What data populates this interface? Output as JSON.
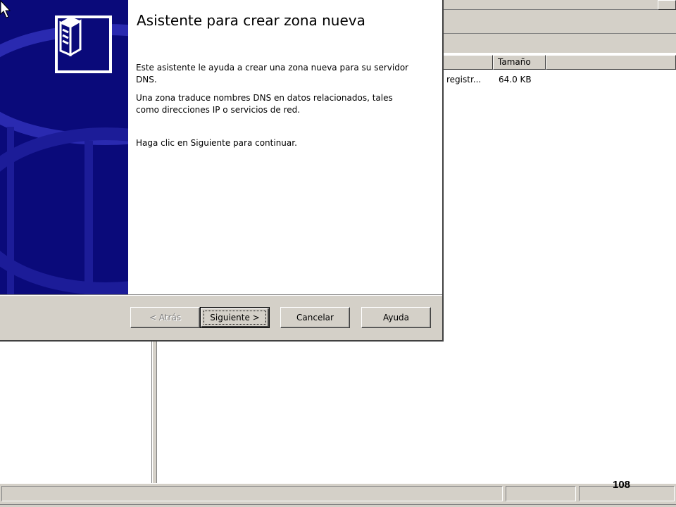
{
  "wizard": {
    "title": "Asistente para crear zona nueva",
    "paragraph1": "Este asistente le ayuda a crear una zona nueva para su servidor DNS.",
    "paragraph2": "Una zona traduce nombres DNS en datos relacionados, tales como direcciones IP o servicios de red.",
    "paragraph3": "Haga clic en Siguiente para continuar.",
    "buttons": {
      "back": "< Atrás",
      "next": "Siguiente >",
      "cancel": "Cancelar",
      "help": "Ayuda"
    }
  },
  "background": {
    "list_header": {
      "size": "Tamaño"
    },
    "list_row": {
      "name": "registr...",
      "size": "64.0 KB"
    }
  },
  "page_number": "108",
  "colors": {
    "banner": "#0a0a7a",
    "dialog_face": "#d4d0c8"
  }
}
